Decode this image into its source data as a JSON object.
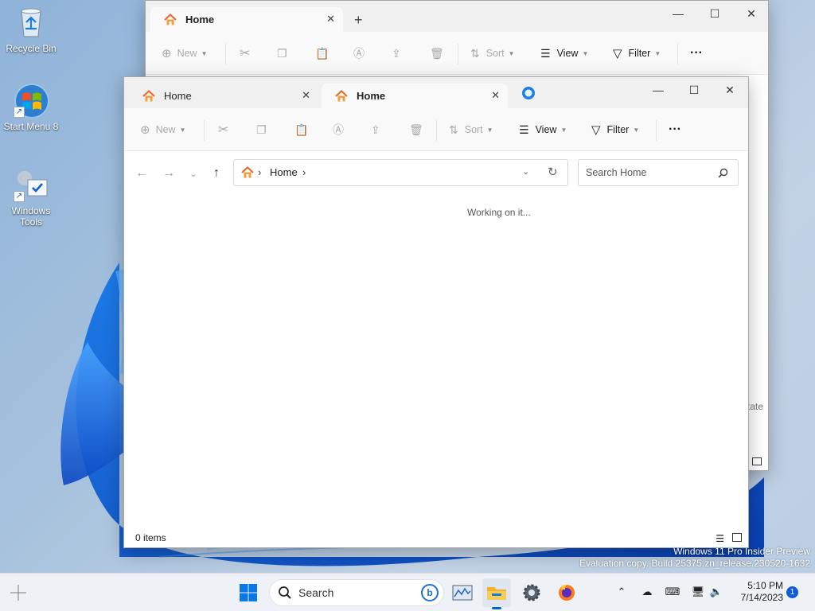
{
  "desktop": {
    "icons": [
      {
        "label": "Recycle Bin",
        "icon": "recycle-bin-icon"
      },
      {
        "label": "Start Menu 8",
        "icon": "start-menu-icon"
      },
      {
        "label": "Windows Tools",
        "icon": "windows-tools-icon"
      }
    ],
    "watermark_line1": "Windows 11 Pro Insider Preview",
    "watermark_line2": "Evaluation copy. Build 25375.zn_release.230520-1632"
  },
  "back_window": {
    "tab_label": "Home",
    "new_tab_symbol": "+",
    "toolbar": {
      "new": "New",
      "sort": "Sort",
      "view": "View",
      "filter": "Filter",
      "more": "···"
    },
    "partial_text": "tate"
  },
  "front_window": {
    "tabs": [
      {
        "label": "Home",
        "active": false
      },
      {
        "label": "Home",
        "active": true
      }
    ],
    "toolbar": {
      "new": "New",
      "sort": "Sort",
      "view": "View",
      "filter": "Filter",
      "more": "···"
    },
    "breadcrumb": {
      "separator": "›",
      "location": "Home"
    },
    "search_placeholder": "Search Home",
    "loading_text": "Working on it...",
    "status_text": "0 items"
  },
  "taskbar": {
    "search_label": "Search",
    "time": "5:10 PM",
    "date": "7/14/2023",
    "notification_count": "1"
  },
  "colors": {
    "accent": "#0067c0",
    "taskbar_bg": "#eef2f7",
    "folder": "#f0b429",
    "home_roof": "#e86b33"
  }
}
